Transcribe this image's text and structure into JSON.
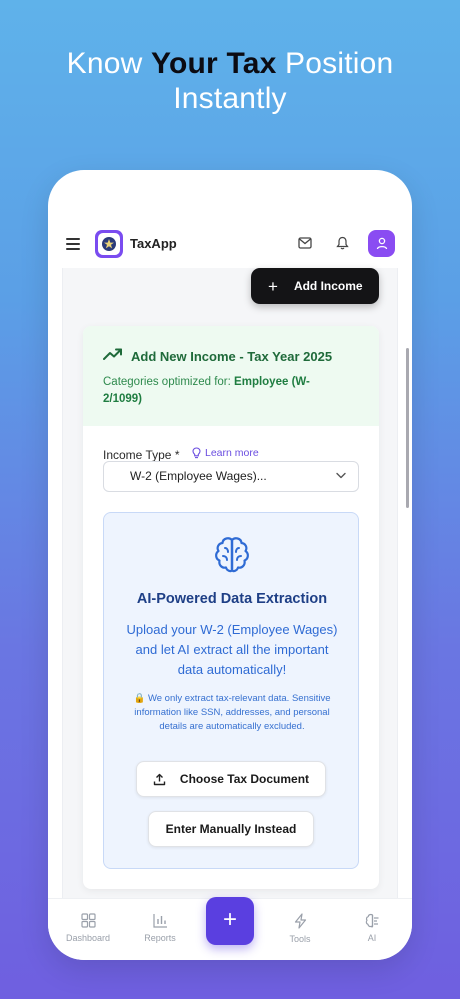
{
  "headline": {
    "part1": "Know ",
    "bold": "Your Tax",
    "part2": " Position",
    "line2": "Instantly"
  },
  "app": {
    "name": "TaxApp"
  },
  "header": {
    "add_income_label": "Add Income"
  },
  "card": {
    "title": "Add New Income - Tax Year 2025",
    "subtitle_prefix": "Categories optimized for: ",
    "subtitle_bold": "Employee (W-2/1099)"
  },
  "income_type": {
    "label": "Income Type *",
    "learn_more": "Learn more",
    "selected_value": "W-2 (Employee Wages)..."
  },
  "ai": {
    "title": "AI-Powered Data Extraction",
    "description": "Upload your W-2 (Employee Wages) and let AI extract all the important data automatically!",
    "note": "🔒 We only extract tax-relevant data. Sensitive information like SSN, addresses, and personal details are automatically excluded.",
    "choose_label": "Choose Tax Document",
    "manual_label": "Enter Manually Instead"
  },
  "nav": {
    "dashboard": "Dashboard",
    "reports": "Reports",
    "add": "+",
    "tools": "Tools",
    "ai": "AI"
  },
  "colors": {
    "accent": "#5a3fe0",
    "avatar": "#8a4cf2",
    "success_bg": "#eefaf1",
    "info_bg": "#eef4fe"
  }
}
